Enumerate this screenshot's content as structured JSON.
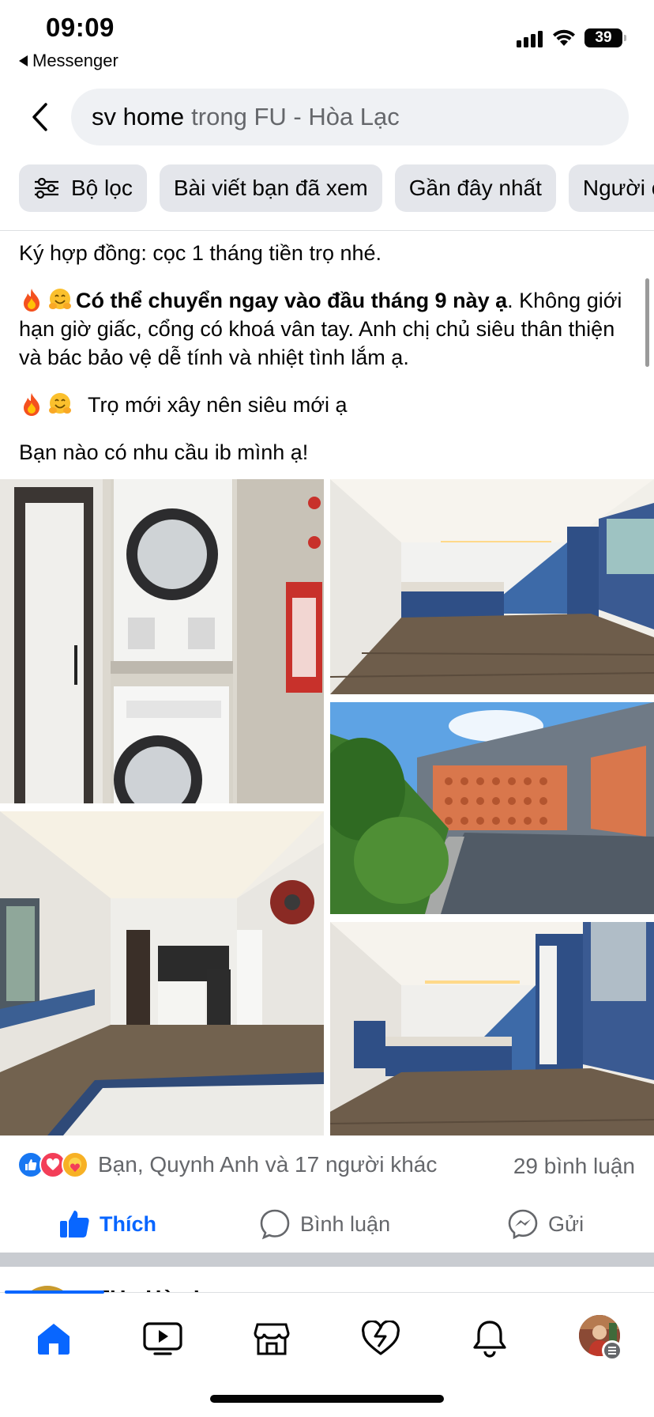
{
  "status_bar": {
    "time": "09:09",
    "back_app": "Messenger",
    "battery": "39"
  },
  "header": {
    "search_query": "sv home",
    "search_scope": "trong FU - Hòa Lạc"
  },
  "filters": [
    {
      "label": "Bộ lọc",
      "icon": "filter-sliders-icon"
    },
    {
      "label": "Bài viết bạn đã xem"
    },
    {
      "label": "Gần đây nhất"
    },
    {
      "label": "Người c"
    }
  ],
  "post": {
    "line_contract": "Ký hợp đồng: cọc 1 tháng tiền trọ nhé.",
    "line_move_bold": "Có thể chuyển ngay vào đầu tháng 9 này ạ",
    "line_move_rest": ". Không giới hạn giờ giấc, cổng có khoá vân tay. Anh chị chủ siêu thân thiện và bác bảo vệ dễ tính và nhiệt tình lắm ạ.",
    "line_new": "Trọ mới xây nên siêu mới ạ",
    "line_contact": "Bạn nào có nhu cầu ib mình ạ!",
    "photos": [
      {
        "subject": "washer-dryer-stack"
      },
      {
        "subject": "bedroom-blue-bed"
      },
      {
        "subject": "rooftop-terrace"
      },
      {
        "subject": "open-room-kitchen"
      },
      {
        "subject": "bedroom-blue-bed-2"
      }
    ],
    "reactions_text": "Bạn, Quynh Anh và 17 người khác",
    "comments_count": "29 bình luận",
    "actions": {
      "like": "Thích",
      "comment": "Bình luận",
      "share": "Gửi"
    }
  },
  "next_post": {
    "name": "FU - Hòa Lạ"
  },
  "colors": {
    "accent": "#0866ff",
    "secondary_text": "#65676b",
    "chip_bg": "#e4e6eb"
  },
  "tabbar": [
    {
      "icon": "home-icon",
      "active": true
    },
    {
      "icon": "video-icon"
    },
    {
      "icon": "marketplace-icon"
    },
    {
      "icon": "dating-heart-icon"
    },
    {
      "icon": "bell-icon"
    },
    {
      "icon": "profile-avatar"
    }
  ]
}
